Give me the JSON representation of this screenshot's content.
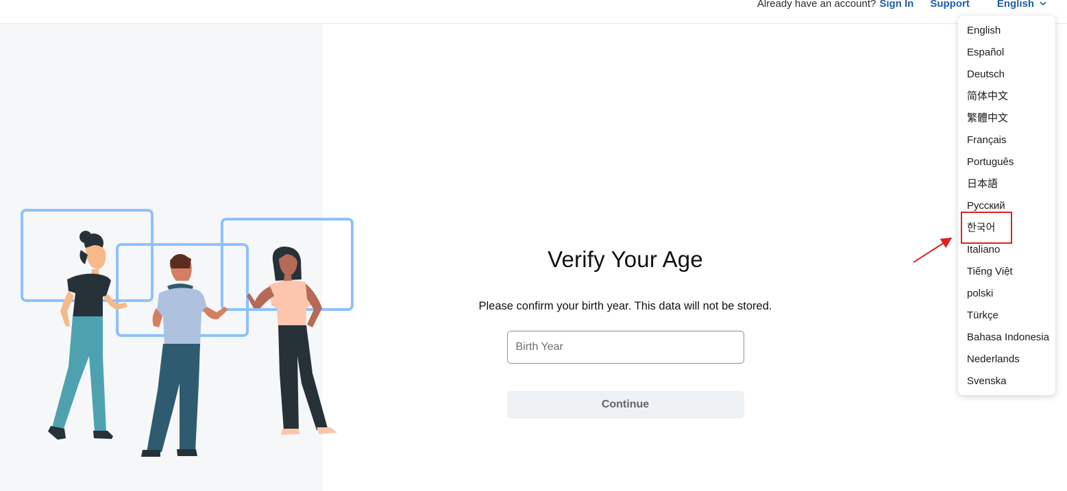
{
  "header": {
    "already_text": "Already have an account?",
    "sign_in": "Sign In",
    "support": "Support",
    "language_selected": "English"
  },
  "main": {
    "title": "Verify Your Age",
    "subtitle": "Please confirm your birth year. This data will not be stored.",
    "birth_year": {
      "value": "",
      "placeholder": "Birth Year"
    },
    "continue_label": "Continue"
  },
  "language_menu": {
    "items": [
      "English",
      "Español",
      "Deutsch",
      "简体中文",
      "繁體中文",
      "Français",
      "Português",
      "日本語",
      "Русский",
      "한국어",
      "Italiano",
      "Tiếng Việt",
      "polski",
      "Türkçe",
      "Bahasa Indonesia",
      "Nederlands",
      "Svenska"
    ],
    "highlighted_item": "한국어"
  },
  "colors": {
    "link": "#1f5fa8",
    "annotation_red": "#e02020",
    "panel_bg": "#f6f7f8",
    "frame_blue": "#8ec0ff"
  },
  "icons": {
    "language_chevron": "chevron-down-icon",
    "annotation_arrow": "arrow-icon"
  }
}
